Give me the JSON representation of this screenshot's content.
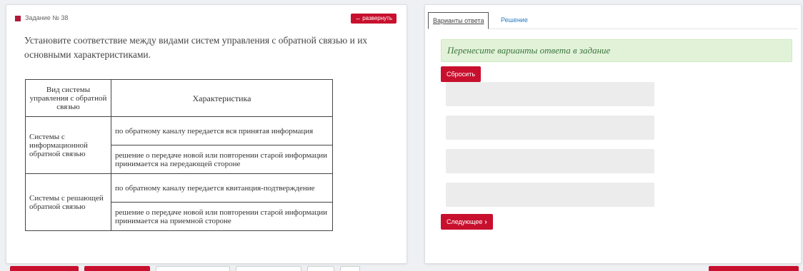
{
  "task": {
    "label": "Задание № 38",
    "expand_label": "развернуть",
    "expand_icon": "↔",
    "text": "Установите соответствие между видами систем управления с обратной связью и их основными характеристиками.",
    "table": {
      "headers": [
        "Вид системы управления с обратной связью",
        "Характеристика"
      ],
      "groups": [
        {
          "type": "Системы с информационной обратной связью",
          "rows": [
            "по обратному каналу передается вся принятая информация",
            "решение о передаче новой или повторении старой информации принимается на передающей стороне"
          ]
        },
        {
          "type": "Системы с решающей обратной связью",
          "rows": [
            "по обратному каналу передается квитанция-подтверждение",
            "решение о передаче новой или повторении старой информации принимается на приемной стороне"
          ]
        }
      ]
    }
  },
  "answer": {
    "tabs": [
      "Варианты ответа",
      "Решение"
    ],
    "hint": "Перенесите варианты ответа в задание",
    "reset_label": "Сбросить",
    "slot_count": 4,
    "next_label": "Следующее",
    "next_icon": "›"
  },
  "colors": {
    "accent": "#c8102e",
    "hint_bg": "#e2f2d9",
    "hint_text": "#3c763d",
    "link": "#2a7ac2"
  }
}
